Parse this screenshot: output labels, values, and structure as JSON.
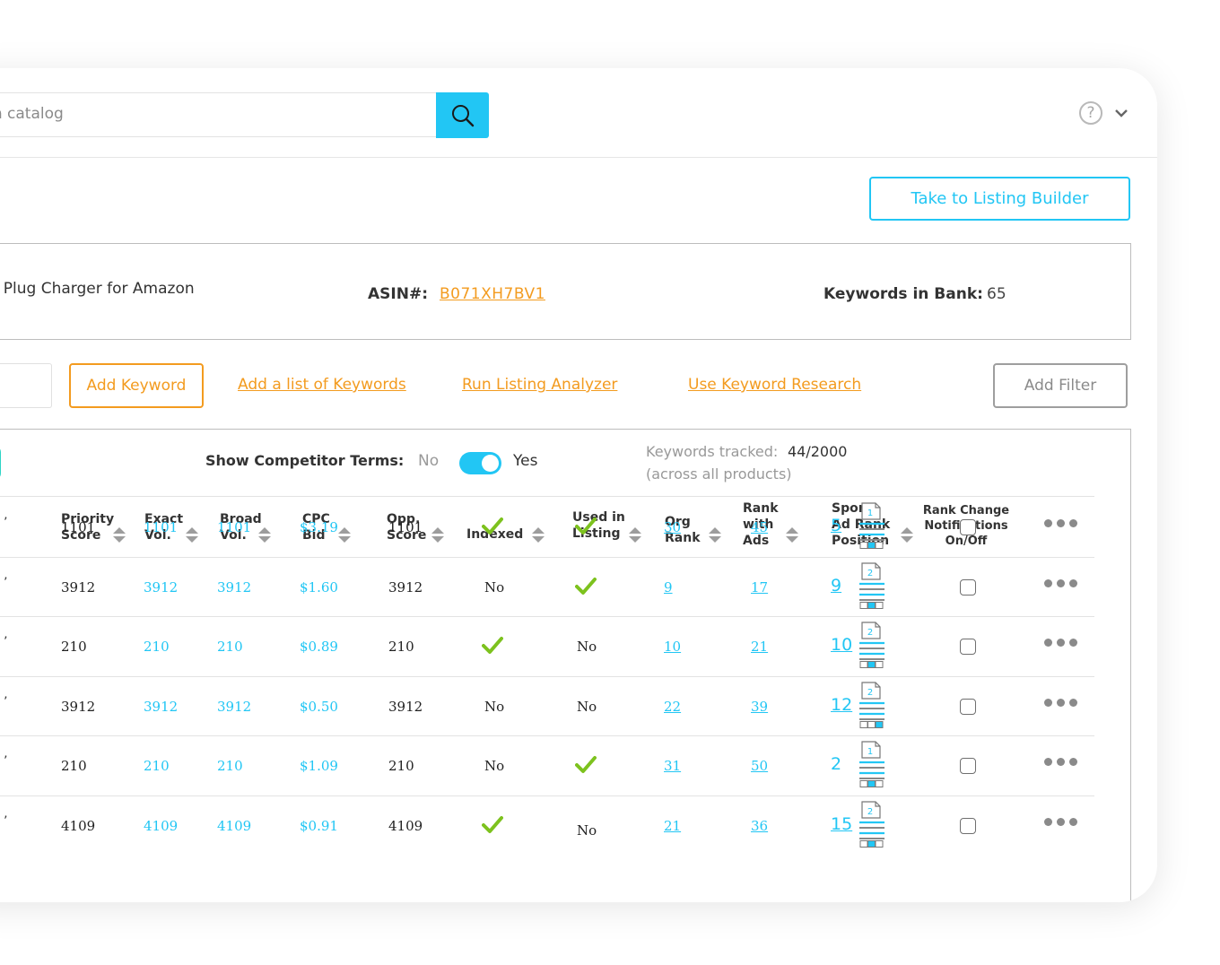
{
  "search": {
    "placeholder": "earch catalog"
  },
  "header": {
    "listing_builder_button": "Take to Listing Builder"
  },
  "product": {
    "title": "o Plug Charger for Amazon",
    "asin_label": "ASIN#:",
    "asin_value": "B071XH7BV1",
    "keywords_in_bank_label": "Keywords in Bank:",
    "keywords_in_bank_value": "65"
  },
  "actions": {
    "add_keyword": "Add Keyword",
    "add_list": "Add a list of Keywords",
    "run_analyzer": "Run Listing Analyzer",
    "use_research": "Use Keyword Research",
    "add_filter": "Add Filter"
  },
  "competitor": {
    "label": "Show Competitor Terms:",
    "no": "No",
    "yes": "Yes",
    "enabled": true
  },
  "tracked": {
    "label": "Keywords tracked:",
    "value": "44/2000",
    "sub": "(across all products)"
  },
  "columns": {
    "priority": [
      "Priority",
      "Score"
    ],
    "exact": [
      "Exact",
      "Vol."
    ],
    "broad": [
      "Broad",
      "Vol."
    ],
    "cpc": [
      "CPC",
      "Bid"
    ],
    "opp": [
      "Opp.",
      "Score"
    ],
    "indexed": "Indexed",
    "used": [
      "Used in",
      "Listing"
    ],
    "org": [
      "Org",
      "Rank"
    ],
    "rank_ads": [
      "Rank",
      "with",
      "Ads"
    ],
    "spons": [
      "Spons.",
      "Ad Rank",
      "Position"
    ],
    "notif": [
      "Rank Change",
      "Notifications",
      "On/Off"
    ]
  },
  "rows": [
    {
      "priority": "1101",
      "exact": "1101",
      "broad": "1101",
      "cpc": "$3.19",
      "opp": "1101",
      "indexed": true,
      "used": true,
      "org": "30",
      "rank_ads": "45",
      "spons": "5",
      "page": "1",
      "slot": 2,
      "underline": true
    },
    {
      "priority": "3912",
      "exact": "3912",
      "broad": "3912",
      "cpc": "$1.60",
      "opp": "3912",
      "indexed": false,
      "used": true,
      "org": "9",
      "rank_ads": "17",
      "spons": "9",
      "page": "2",
      "slot": 2,
      "underline": true
    },
    {
      "priority": "210",
      "exact": "210",
      "broad": "210",
      "cpc": "$0.89",
      "opp": "210",
      "indexed": true,
      "used": false,
      "org": "10",
      "rank_ads": "21",
      "spons": "10",
      "page": "2",
      "slot": 2,
      "underline": true
    },
    {
      "priority": "3912",
      "exact": "3912",
      "broad": "3912",
      "cpc": "$0.50",
      "opp": "3912",
      "indexed": false,
      "used": false,
      "org": "22",
      "rank_ads": "39",
      "spons": "12",
      "page": "2",
      "slot": 3,
      "underline": true
    },
    {
      "priority": "210",
      "exact": "210",
      "broad": "210",
      "cpc": "$1.09",
      "opp": "210",
      "indexed": false,
      "used": true,
      "org": "31",
      "rank_ads": "50",
      "spons": "2",
      "page": "1",
      "slot": 2,
      "underline": false
    },
    {
      "priority": "4109",
      "exact": "4109",
      "broad": "4109",
      "cpc": "$0.91",
      "opp": "4109",
      "indexed": true,
      "used": false,
      "org": "21",
      "rank_ads": "36",
      "spons": "15",
      "page": "2",
      "slot": 2,
      "underline": true
    }
  ],
  "no_text": "No",
  "colors": {
    "accent": "#22c6f4",
    "orange": "#f39b1f",
    "check": "#7dc21e",
    "teal": "#2ed4c6"
  }
}
